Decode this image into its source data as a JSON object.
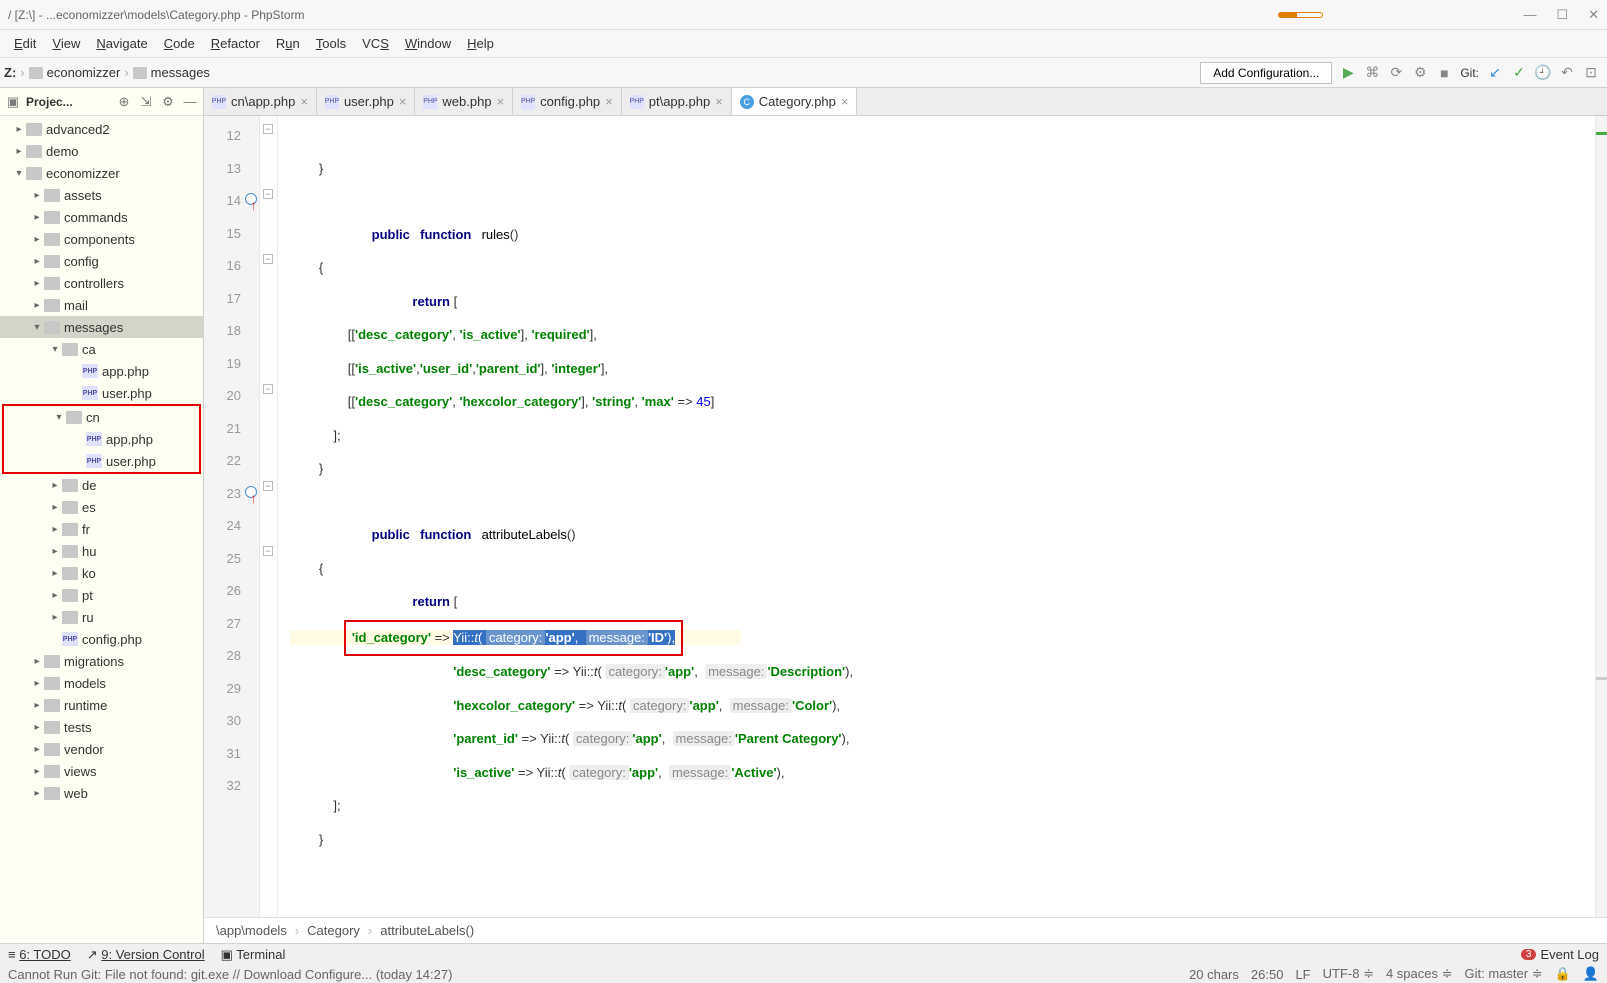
{
  "title": "/ [Z:\\] - ...economizzer\\models\\Category.php - PhpStorm",
  "menu": [
    "Edit",
    "View",
    "Navigate",
    "Code",
    "Refactor",
    "Run",
    "Tools",
    "VCS",
    "Window",
    "Help"
  ],
  "menu_underline": [
    "E",
    "V",
    "N",
    "C",
    "R",
    "u",
    "T",
    "S",
    "W",
    "H"
  ],
  "breadcrumb": {
    "root": "Z:",
    "items": [
      "economizzer",
      "messages"
    ]
  },
  "toolbar": {
    "config": "Add Configuration...",
    "git": "Git:"
  },
  "sidebar": {
    "title": "Projec...",
    "tree": [
      {
        "lvl": 1,
        "arrow": ">",
        "type": "fld",
        "label": "advanced2"
      },
      {
        "lvl": 1,
        "arrow": ">",
        "type": "fld",
        "label": "demo"
      },
      {
        "lvl": 1,
        "arrow": "v",
        "type": "fld",
        "label": "economizzer"
      },
      {
        "lvl": 2,
        "arrow": ">",
        "type": "fld",
        "label": "assets"
      },
      {
        "lvl": 2,
        "arrow": ">",
        "type": "fld",
        "label": "commands"
      },
      {
        "lvl": 2,
        "arrow": ">",
        "type": "fld",
        "label": "components"
      },
      {
        "lvl": 2,
        "arrow": ">",
        "type": "fld",
        "label": "config"
      },
      {
        "lvl": 2,
        "arrow": ">",
        "type": "fld",
        "label": "controllers"
      },
      {
        "lvl": 2,
        "arrow": ">",
        "type": "fld",
        "label": "mail"
      },
      {
        "lvl": 2,
        "arrow": "v",
        "type": "fld",
        "label": "messages",
        "sel": true
      },
      {
        "lvl": 3,
        "arrow": "v",
        "type": "fld",
        "label": "ca"
      },
      {
        "lvl": 4,
        "arrow": "",
        "type": "php",
        "label": "app.php"
      },
      {
        "lvl": 4,
        "arrow": "",
        "type": "php",
        "label": "user.php"
      }
    ],
    "tree_hl": [
      {
        "lvl": 3,
        "arrow": "v",
        "type": "fld",
        "label": "cn"
      },
      {
        "lvl": 4,
        "arrow": "",
        "type": "php",
        "label": "app.php"
      },
      {
        "lvl": 4,
        "arrow": "",
        "type": "php",
        "label": "user.php"
      }
    ],
    "tree2": [
      {
        "lvl": 3,
        "arrow": ">",
        "type": "fld",
        "label": "de"
      },
      {
        "lvl": 3,
        "arrow": ">",
        "type": "fld",
        "label": "es"
      },
      {
        "lvl": 3,
        "arrow": ">",
        "type": "fld",
        "label": "fr"
      },
      {
        "lvl": 3,
        "arrow": ">",
        "type": "fld",
        "label": "hu"
      },
      {
        "lvl": 3,
        "arrow": ">",
        "type": "fld",
        "label": "ko"
      },
      {
        "lvl": 3,
        "arrow": ">",
        "type": "fld",
        "label": "pt"
      },
      {
        "lvl": 3,
        "arrow": ">",
        "type": "fld",
        "label": "ru"
      },
      {
        "lvl": 3,
        "arrow": "",
        "type": "php",
        "label": "config.php"
      },
      {
        "lvl": 2,
        "arrow": ">",
        "type": "fld",
        "label": "migrations"
      },
      {
        "lvl": 2,
        "arrow": ">",
        "type": "fld",
        "label": "models"
      },
      {
        "lvl": 2,
        "arrow": ">",
        "type": "fld",
        "label": "runtime"
      },
      {
        "lvl": 2,
        "arrow": ">",
        "type": "fld",
        "label": "tests"
      },
      {
        "lvl": 2,
        "arrow": ">",
        "type": "fld",
        "label": "vendor"
      },
      {
        "lvl": 2,
        "arrow": ">",
        "type": "fld",
        "label": "views"
      },
      {
        "lvl": 2,
        "arrow": ">",
        "type": "fld",
        "label": "web"
      }
    ]
  },
  "tabs": [
    {
      "icon": "php",
      "label": "cn\\app.php"
    },
    {
      "icon": "php",
      "label": "user.php"
    },
    {
      "icon": "php",
      "label": "web.php"
    },
    {
      "icon": "php",
      "label": "config.php"
    },
    {
      "icon": "php",
      "label": "pt\\app.php"
    },
    {
      "icon": "cls",
      "label": "Category.php",
      "active": true
    }
  ],
  "gutter_lines": [
    "12",
    "13",
    "14",
    "15",
    "16",
    "17",
    "18",
    "19",
    "20",
    "21",
    "22",
    "23",
    "24",
    "25",
    "26",
    "27",
    "28",
    "29",
    "30",
    "31",
    "32"
  ],
  "code_bc": [
    "\\app\\models",
    "Category",
    "attributeLabels()"
  ],
  "bottom": {
    "todo": "6: TODO",
    "vcs": "9: Version Control",
    "term": "Terminal",
    "evlog": "Event Log",
    "evcnt": "3"
  },
  "status": {
    "msg": "Cannot Run Git: File not found: git.exe // Download Configure... (today 14:27)",
    "chars": "20 chars",
    "pos": "26:50",
    "lf": "LF",
    "enc": "UTF-8",
    "indent": "4 spaces",
    "branch": "Git: master"
  },
  "code": {
    "l12": "        }",
    "l14_pub": "public",
    "l14_fn": "function",
    "l14_name": "rules",
    "l14_p": "()",
    "l15": "        {",
    "l16_ret": "return",
    "l16_b": " [",
    "l17_a": "                [[",
    "l17_s1": "'desc_category'",
    "l17_c1": ", ",
    "l17_s2": "'is_active'",
    "l17_c2": "], ",
    "l17_s3": "'required'",
    "l17_e": "],",
    "l18_a": "                [[",
    "l18_s1": "'is_active'",
    "l18_c1": ",",
    "l18_s2": "'user_id'",
    "l18_c2": ",",
    "l18_s3": "'parent_id'",
    "l18_c3": "], ",
    "l18_s4": "'integer'",
    "l18_e": "],",
    "l19_a": "                [[",
    "l19_s1": "'desc_category'",
    "l19_c1": ", ",
    "l19_s2": "'hexcolor_category'",
    "l19_c2": "], ",
    "l19_s3": "'string'",
    "l19_c3": ", ",
    "l19_s4": "'max'",
    "l19_ar": " => ",
    "l19_n": "45",
    "l19_e": "]",
    "l20": "            ];",
    "l21": "        }",
    "l23_pub": "public",
    "l23_fn": "function",
    "l23_name": "attributeLabels",
    "l23_p": "()",
    "l24": "        {",
    "l25_ret": "return",
    "l25_b": " [",
    "l26_s1": "'id_category'",
    "l26_ar": " => ",
    "l26_yii": "Yii::",
    "l26_t": "t",
    "l26_p1": "( ",
    "l26_h1": "category:",
    "l26_s2": "'app'",
    "l26_c": ",  ",
    "l26_h2": "message:",
    "l26_s3": "'ID'",
    "l26_p2": "),",
    "l27_s1": "'desc_category'",
    "l27_ar": " => ",
    "l27_yii": "Yii::",
    "l27_t": "t",
    "l27_p1": "( ",
    "l27_h1": "category:",
    "l27_s2": "'app'",
    "l27_c": ",  ",
    "l27_h2": "message:",
    "l27_s3": "'Description'",
    "l27_p2": "),",
    "l28_s1": "'hexcolor_category'",
    "l28_ar": " => ",
    "l28_yii": "Yii::",
    "l28_t": "t",
    "l28_p1": "( ",
    "l28_h1": "category:",
    "l28_s2": "'app'",
    "l28_c": ",  ",
    "l28_h2": "message:",
    "l28_s3": "'Color'",
    "l28_p2": "),",
    "l29_s1": "'parent_id'",
    "l29_ar": " => ",
    "l29_yii": "Yii::",
    "l29_t": "t",
    "l29_p1": "( ",
    "l29_h1": "category:",
    "l29_s2": "'app'",
    "l29_c": ",  ",
    "l29_h2": "message:",
    "l29_s3": "'Parent Category'",
    "l29_p2": "),",
    "l30_s1": "'is_active'",
    "l30_ar": " => ",
    "l30_yii": "Yii::",
    "l30_t": "t",
    "l30_p1": "( ",
    "l30_h1": "category:",
    "l30_s2": "'app'",
    "l30_c": ",  ",
    "l30_h2": "message:",
    "l30_s3": "'Active'",
    "l30_p2": "),",
    "l31": "            ];",
    "l32": "        }"
  }
}
